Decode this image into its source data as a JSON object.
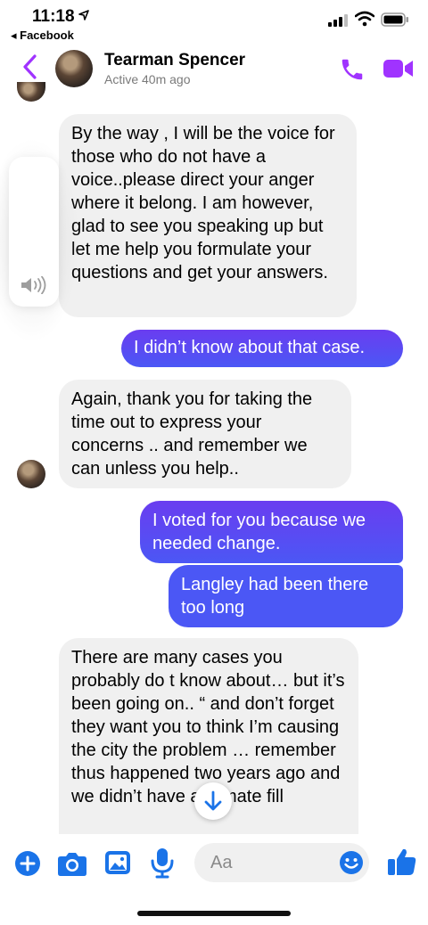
{
  "status_bar": {
    "time": "11:18",
    "back_app": "Facebook"
  },
  "header": {
    "name": "Tearman Spencer",
    "status": "Active 40m ago",
    "accent": "#a033ff"
  },
  "messages": [
    {
      "direction": "incoming",
      "text": "By the way , I will be the voice for those who do not have a voice..please direct your anger where it belong.  I am however, glad to see you speaking up but let me help you formulate your questions and get your answers."
    },
    {
      "direction": "outgoing",
      "text": "I didn’t know about that case."
    },
    {
      "direction": "incoming",
      "text": "Again, thank you for taking the time out to express your concerns .. and remember we can unless you help.."
    },
    {
      "direction": "outgoing",
      "text": "I voted for you because we needed change."
    },
    {
      "direction": "outgoing",
      "text": "Langley had been there too long"
    },
    {
      "direction": "incoming",
      "text": "There are many cases you probably do t know about… but it’s been going on.. “ and don’t forget they want you to think I’m causing the city the problem … remember thus happened two years ago and we didn’t have a climate fill"
    }
  ],
  "composer": {
    "placeholder": "Aa"
  },
  "colors": {
    "outgoing_top": "#6a3df0",
    "outgoing_bottom": "#4b57f5",
    "incoming_bg": "#f0f0f0",
    "composer_icons": "#1a73e8"
  },
  "icons": [
    "location-arrow",
    "signal",
    "wifi",
    "battery",
    "back-chevron",
    "phone",
    "video-camera",
    "volume",
    "arrow-down",
    "plus",
    "camera",
    "gallery",
    "microphone",
    "emoji",
    "thumbs-up"
  ]
}
